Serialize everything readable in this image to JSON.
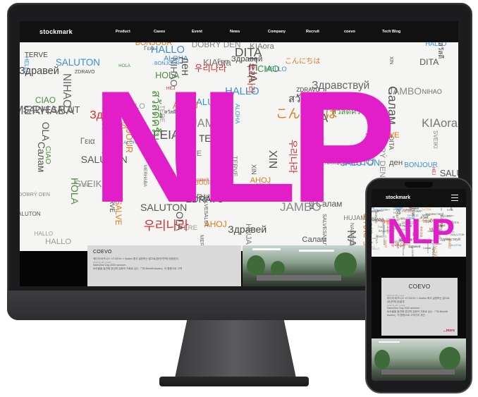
{
  "desktop": {
    "logo": "stockmark",
    "menu": [
      "Product",
      "Cases",
      "Event",
      "News",
      "Company",
      "Recruit",
      "coevo",
      "Tech Blog"
    ],
    "hero_title": "NLP",
    "hero_words": [
      {
        "text": "우리나라",
        "color": "#d62b2b"
      },
      {
        "text": "Здравей",
        "color": "#444"
      },
      {
        "text": "SALUTON",
        "color": "#3a8fd4"
      },
      {
        "text": "Салам",
        "color": "#555"
      },
      {
        "text": "SALUTON",
        "color": "#555"
      },
      {
        "text": "HALLO",
        "color": "#999"
      },
      {
        "text": "MERHABA",
        "color": "#666"
      },
      {
        "text": "AHOJ",
        "color": "#e07a1f"
      },
      {
        "text": "SVEIKI",
        "color": "#888"
      },
      {
        "text": "HOLA",
        "color": "#4b8e3c"
      },
      {
        "text": "ALOHA",
        "color": "#3a8fd4"
      },
      {
        "text": "DITA",
        "color": "#555"
      },
      {
        "text": "ZDRAVO",
        "color": "#444"
      },
      {
        "text": "BONJOUR",
        "color": "#3a8fd4"
      },
      {
        "text": "Здравей",
        "color": "#d62b2b"
      },
      {
        "text": "ΓΕΙΑ",
        "color": "#555"
      },
      {
        "text": "SALVE",
        "color": "#e07a1f"
      },
      {
        "text": "TERVE",
        "color": "#444"
      },
      {
        "text": "HUJAMBO",
        "color": "#777"
      },
      {
        "text": "Здравствуй",
        "color": "#666"
      },
      {
        "text": "SALVESALUT",
        "color": "#555"
      },
      {
        "text": "BONJOUR",
        "color": "#e07a1f"
      },
      {
        "text": "HALLO",
        "color": "#3a8fd4"
      },
      {
        "text": "KIAora",
        "color": "#777"
      },
      {
        "text": "ден",
        "color": "#555"
      },
      {
        "text": "NAMASTE",
        "color": "#666"
      },
      {
        "text": "TERE",
        "color": "#999"
      },
      {
        "text": "JAMBO",
        "color": "#888"
      },
      {
        "text": "HELLO",
        "color": "#3a8fd4"
      },
      {
        "text": "こんにちは",
        "color": "#e07a1f"
      },
      {
        "text": "CIAO",
        "color": "#4b8e3c"
      },
      {
        "text": "HEJ",
        "color": "#d62b2b"
      },
      {
        "text": "NIHAO",
        "color": "#666"
      },
      {
        "text": "OLA",
        "color": "#555"
      },
      {
        "text": "DOBRÝ DEN",
        "color": "#888"
      },
      {
        "text": "สวัสดีครับ",
        "color": "#4b8e3c"
      },
      {
        "text": "สวัสดี",
        "color": "#444"
      },
      {
        "text": "XIN",
        "color": "#555"
      },
      {
        "text": "Γεια",
        "color": "#666"
      },
      {
        "text": "TERVE",
        "color": "#777"
      }
    ],
    "news": {
      "title": "COEVO",
      "items": [
        {
          "meta": "2020.11.30 | news",
          "text": "에디아·비즈니스 «IT-BOX» × Asales 에서 실현하는 말으로(영/전/번역)*영중한리"
        },
        {
          "meta": "2020.11.18 | media",
          "text": "SalesZine Day 2020 summer -"
        },
        {
          "meta": "",
          "text": "트라볼을 발견해 영업력 강화의 기회로 삼는 「TB Benefit Asales」의 활용으로 고객"
        }
      ]
    }
  },
  "phone": {
    "logo": "stockmark",
    "hero_title": "NLP",
    "news": {
      "title": "COEVO",
      "items": [
        {
          "meta": "2020.11.30 | news",
          "text": "미디어·비즈니스 «IT-BOX» × Asales 에서 실현하는 말으로(한)번역(영)결과"
        },
        {
          "meta": "2020.11.18 | media",
          "text": "SalesZine Day 2020 summer -"
        },
        {
          "meta": "",
          "text": "트라볼을 발견해 영업력 강화의 기회로 삼는 「TB Benefit Asales」의 활용으로 고객가치 개선"
        }
      ],
      "more": "...more"
    }
  },
  "colors": {
    "accent": "#e21ec8",
    "more_link": "#c4164a",
    "frame": "#1c1c1e"
  }
}
